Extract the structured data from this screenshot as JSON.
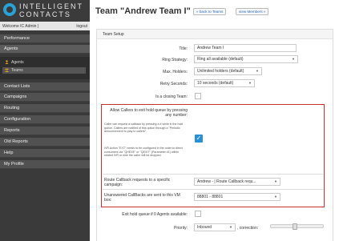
{
  "brand": {
    "line1": "INTELLIGENT",
    "line2": "CONTACTS"
  },
  "session": {
    "welcome": "Welcome IC Admin |",
    "logout": "logout"
  },
  "nav": {
    "performance": "Performance",
    "agents": "Agents",
    "sub_agents": "Agents",
    "sub_teams": "Teams",
    "contact_lists": "Contact Lists",
    "campaigns": "Campaigns",
    "routing": "Routing",
    "configuration": "Configuration",
    "reports": "Reports",
    "old_reports": "Old Reports",
    "help": "Help",
    "my_profile": "My Profile"
  },
  "page": {
    "title": "Team \"Andrew Team I\"",
    "back_label": "« back to Teams",
    "view_members_label": "view Members »",
    "panel_title": "Team Setup"
  },
  "form": {
    "title_label": "Title:",
    "title_value": "Andrew Team I",
    "ring_label": "Ring Strategy:",
    "ring_value": "Ring all available (default)",
    "max_holders_label": "Max. Holders:",
    "max_holders_value": "Unlimited holders (default)",
    "retry_label": "Retry Seconds:",
    "retry_value": "10 seconds (default)",
    "closing_label": "Is a closing Team:",
    "allow_exit_label": "Allow Callers to exit hold queue by pressing any number:",
    "help1": "Caller can request a callback by pressing a # while in the hold queue. Callers are notified of this option through a \"Periodic announcement to play to callers\".",
    "help2": "IVR Action \"EXT\" needs to be configured in the order to direct consumers via \"QHEXE\" or \"QEXIT\" (Parameter #1) within related IVR or else the caller will be dropped.",
    "route_label": "Route Callback requests to a specific campaign:",
    "route_value": "Andrew - | Route Callback requ...",
    "unanswered_label": "Unanswered CallBacks are sent to this VM box:",
    "unanswered_value": "88801 - 88801",
    "exit_zero_label": "Exit hold queue if 0 Agents available:",
    "priority_label": "Priority:",
    "priority_value": "Inbound",
    "correction_label": ", correction:",
    "correction_level": 0.45
  },
  "colors": {
    "accent_blue": "#2a8fd4",
    "highlight_red": "#c9302c",
    "sidebar": "#3a3a3a"
  }
}
